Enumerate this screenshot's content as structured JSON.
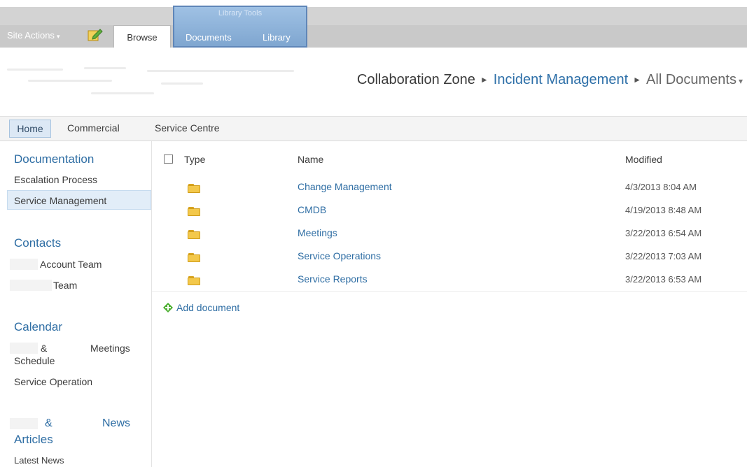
{
  "ribbon": {
    "site_actions": "Site Actions",
    "tabs": {
      "browse": "Browse",
      "documents": "Documents",
      "library": "Library"
    },
    "tool_group_title": "Library Tools"
  },
  "breadcrumb": {
    "root": "Collaboration Zone",
    "current": "Incident Management",
    "view": "All Documents"
  },
  "topnav": {
    "items": [
      "Home",
      "Commercial",
      "Service Centre"
    ]
  },
  "quicklaunch": {
    "documentation": {
      "heading": "Documentation",
      "links": [
        "Escalation Process",
        "Service Management"
      ]
    },
    "contacts": {
      "heading": "Contacts",
      "links": [
        "Account Team",
        "Team"
      ]
    },
    "calendar": {
      "heading": "Calendar",
      "links": [
        {
          "a": "&",
          "b": "Meetings",
          "c": "Schedule"
        },
        "Service Operation"
      ]
    },
    "news": {
      "a": "&",
      "b": "News",
      "c": "Articles",
      "links": [
        "Latest News"
      ]
    }
  },
  "list": {
    "columns": {
      "type": "Type",
      "name": "Name",
      "modified": "Modified"
    },
    "rows": [
      {
        "name": "Change Management",
        "modified": "4/3/2013 8:04 AM"
      },
      {
        "name": "CMDB",
        "modified": "4/19/2013 8:48 AM"
      },
      {
        "name": "Meetings",
        "modified": "3/22/2013 6:54 AM"
      },
      {
        "name": "Service Operations",
        "modified": "3/22/2013 7:03 AM"
      },
      {
        "name": "Service Reports",
        "modified": "3/22/2013 6:53 AM"
      }
    ],
    "add_document": "Add document"
  },
  "colors": {
    "link": "#2f6ea4",
    "ribbon_group": "#7fa6d0",
    "selected": "#e2edf8"
  },
  "icons": [
    "edit-page-icon",
    "folder-icon",
    "add-icon",
    "checkbox"
  ]
}
